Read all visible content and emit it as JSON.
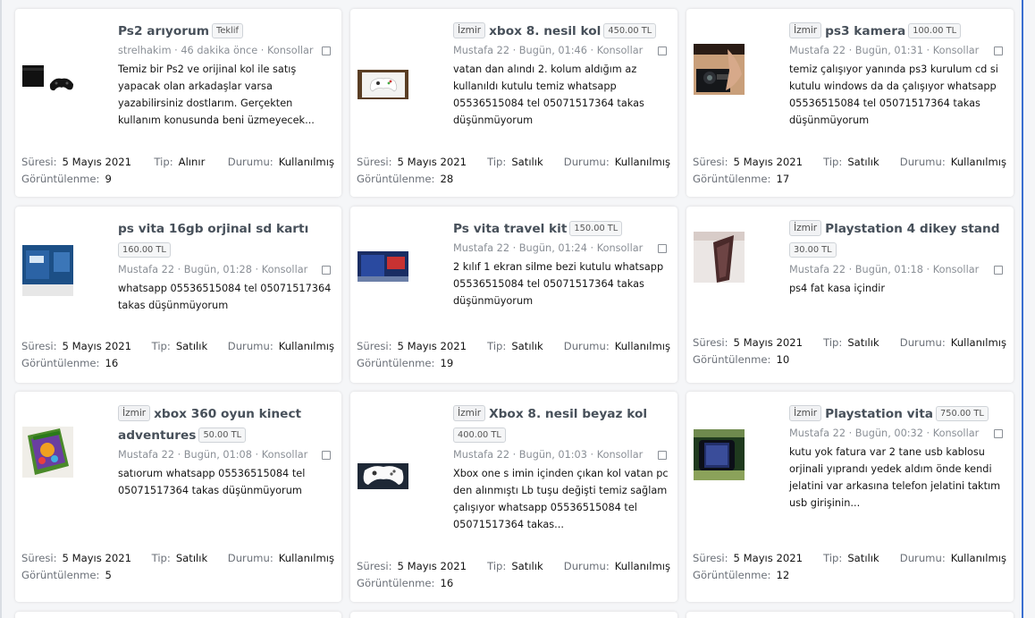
{
  "common": {
    "sure_key": "Süresi:",
    "tip_key": "Tip:",
    "durum_key": "Durumu:",
    "views_key": "Görüntülenme:",
    "sep": "·"
  },
  "listings": [
    {
      "location": "",
      "title": "Ps2 arıyorum",
      "badge": "Teklif",
      "user": "strelhakim",
      "time": "46 dakika önce",
      "category": "Konsollar",
      "desc": "Temiz bir Ps2 ve orijinal kol ile satış yapacak olan arkadaşlar varsa yazabilirsiniz dostlarım. Gerçekten kullanım konusunda beni üzmeyecek...",
      "sure": "5 Mayıs 2021",
      "tip": "Alınır",
      "durum": "Kullanılmış",
      "views": "9",
      "image": "ps2-console-image"
    },
    {
      "location": "İzmir",
      "title": "xbox 8. nesil kol",
      "badge": "450.00 TL",
      "user": "Mustafa 22",
      "time": "Bugün, 01:46",
      "category": "Konsollar",
      "desc": "vatan dan alındı 2. kolum aldığım az kullanıldı kutulu temiz whatsapp 05536515084 tel 05071517364 takas düşünmüyorum",
      "sure": "5 Mayıs 2021",
      "tip": "Satılık",
      "durum": "Kullanılmış",
      "views": "28",
      "image": "xbox-controller-image"
    },
    {
      "location": "İzmir",
      "title": "ps3 kamera",
      "badge": "100.00 TL",
      "user": "Mustafa 22",
      "time": "Bugün, 01:31",
      "category": "Konsollar",
      "desc": "temiz çalışıyor yanında ps3 kurulum cd si kutulu windows da da çalışıyor whatsapp 05536515084 tel 05071517364 takas düşünmüyorum",
      "sure": "5 Mayıs 2021",
      "tip": "Satılık",
      "durum": "Kullanılmış",
      "views": "17",
      "image": "ps3-camera-image"
    },
    {
      "location": "",
      "title": "ps vita 16gb orjinal sd kartı",
      "badge": "160.00 TL",
      "user": "Mustafa 22",
      "time": "Bugün, 01:28",
      "category": "Konsollar",
      "desc": "whatsapp 05536515084 tel 05071517364 takas düşünmüyorum",
      "sure": "5 Mayıs 2021",
      "tip": "Satılık",
      "durum": "Kullanılmış",
      "views": "16",
      "image": "memory-card-image"
    },
    {
      "location": "",
      "title": "Ps vita travel kit",
      "badge": "150.00 TL",
      "user": "Mustafa 22",
      "time": "Bugün, 01:24",
      "category": "Konsollar",
      "desc": "2 kılıf 1 ekran silme bezi kutulu whatsapp 05536515084 tel 05071517364 takas düşünmüyorum",
      "sure": "5 Mayıs 2021",
      "tip": "Satılık",
      "durum": "Kullanılmış",
      "views": "19",
      "image": "travel-kit-image"
    },
    {
      "location": "İzmir",
      "title": "Playstation 4 dikey stand",
      "badge": "30.00 TL",
      "user": "Mustafa 22",
      "time": "Bugün, 01:18",
      "category": "Konsollar",
      "desc": "ps4 fat kasa içindir",
      "sure": "5 Mayıs 2021",
      "tip": "Satılık",
      "durum": "Kullanılmış",
      "views": "10",
      "image": "vertical-stand-image"
    },
    {
      "location": "İzmir",
      "title": "xbox 360 oyun kinect adventures",
      "badge": "50.00 TL",
      "user": "Mustafa 22",
      "time": "Bugün, 01:08",
      "category": "Konsollar",
      "desc": "satıorum whatsapp 05536515084 tel 05071517364 takas düşünmüyorum",
      "sure": "5 Mayıs 2021",
      "tip": "Satılık",
      "durum": "Kullanılmış",
      "views": "5",
      "image": "game-case-image"
    },
    {
      "location": "İzmir",
      "title": "Xbox 8. nesil beyaz kol",
      "badge": "400.00 TL",
      "user": "Mustafa 22",
      "time": "Bugün, 01:03",
      "category": "Konsollar",
      "desc": "Xbox one s imin içinden çıkan kol vatan pc den alınmıştı Lb tuşu değişti temiz sağlam çalışıyor whatsapp 05536515084 tel 05071517364 takas...",
      "sure": "5 Mayıs 2021",
      "tip": "Satılık",
      "durum": "Kullanılmış",
      "views": "16",
      "image": "white-controller-image"
    },
    {
      "location": "İzmir",
      "title": "Playstation vita",
      "badge": "750.00 TL",
      "user": "Mustafa 22",
      "time": "Bugün, 00:32",
      "category": "Konsollar",
      "desc": "kutu yok fatura var 2 tane usb kablosu orjinali yıprandı yedek aldım önde kendi jelatini var arkasına telefon jelatini taktım usb girişinin...",
      "sure": "5 Mayıs 2021",
      "tip": "Satılık",
      "durum": "Kullanılmış",
      "views": "12",
      "image": "ps-vita-image"
    }
  ]
}
